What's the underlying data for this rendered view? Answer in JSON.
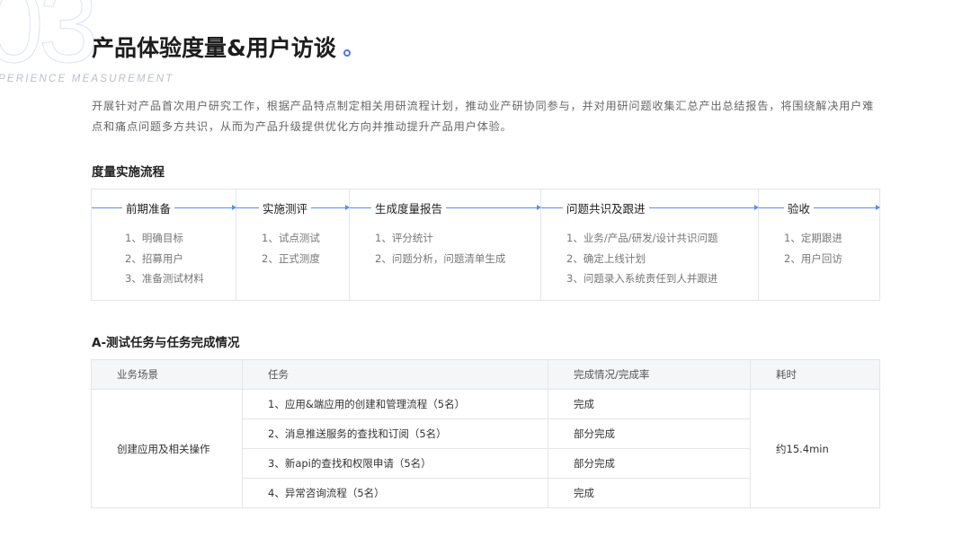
{
  "header": {
    "big_number": "03",
    "subtitle_en": "PERIENCE MEASUREMENT",
    "title": "产品体验度量&用户访谈"
  },
  "intro": "开展针对产品首次用户研究工作，根据产品特点制定相关用研流程计划，推动业产研协同参与，并对用研问题收集汇总产出总结报告，将围绕解决用户难点和痛点问题多方共识，从而为产品升级提供优化方向并推动提升产品用户体验。",
  "process": {
    "title": "度量实施流程",
    "stages": [
      {
        "head": "前期准备",
        "items": [
          "1、明确目标",
          "2、招募用户",
          "3、准备测试材料"
        ]
      },
      {
        "head": "实施测评",
        "items": [
          "1、试点测试",
          "2、正式测度"
        ]
      },
      {
        "head": "生成度量报告",
        "items": [
          "1、评分统计",
          "2、问题分析，问题清单生成"
        ]
      },
      {
        "head": "问题共识及跟进",
        "items": [
          "1、业务/产品/研发/设计共识问题",
          "2、确定上线计划",
          "3、问题录入系统责任到人并跟进"
        ]
      },
      {
        "head": "验收",
        "items": [
          "1、定期跟进",
          "2、用户回访"
        ]
      }
    ]
  },
  "tasks": {
    "title": "A-测试任务与任务完成情况",
    "headers": [
      "业务场景",
      "任务",
      "完成情况/完成率",
      "耗时"
    ],
    "scenario": "创建应用及相关操作",
    "time": "约15.4min",
    "rows": [
      {
        "task": "1、应用&端应用的创建和管理流程（5名）",
        "status": "完成"
      },
      {
        "task": "2、消息推送服务的查找和订阅（5名）",
        "status": "部分完成"
      },
      {
        "task": "3、新api的查找和权限申请（5名）",
        "status": "部分完成"
      },
      {
        "task": "4、异常咨询流程（5名）",
        "status": "完成"
      }
    ]
  }
}
